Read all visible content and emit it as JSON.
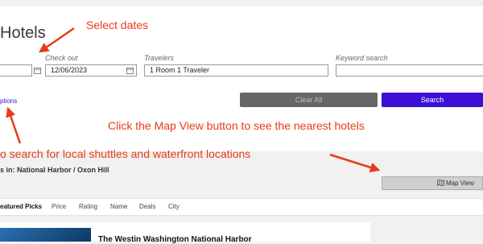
{
  "page": {
    "title": "Hotels"
  },
  "search": {
    "checkout_label": "Check out",
    "checkout_value": "12/06/2023",
    "travelers_label": "Travelers",
    "travelers_value": "1 Room 1 Traveler",
    "keyword_label": "Keyword search",
    "keyword_value": "",
    "options_link": "ptions",
    "clear_label": "Clear All",
    "search_label": "Search"
  },
  "annotations": {
    "select_dates": "Select dates",
    "map_hint": "Click the Map View button to see the nearest hotels",
    "shuttle_hint": "o search for local shuttles and waterfront locations"
  },
  "results": {
    "location_text": "s in: National Harbor / Oxon Hill",
    "map_view_label": "Map View"
  },
  "sort": {
    "tabs": [
      "eatured Picks",
      "Price",
      "Rating",
      "Name",
      "Deals",
      "City"
    ]
  },
  "hotels": [
    {
      "name": "The Westin Washington National Harbor"
    }
  ],
  "colors": {
    "accent": "#3b0fd4",
    "annotation": "#e83a18"
  }
}
